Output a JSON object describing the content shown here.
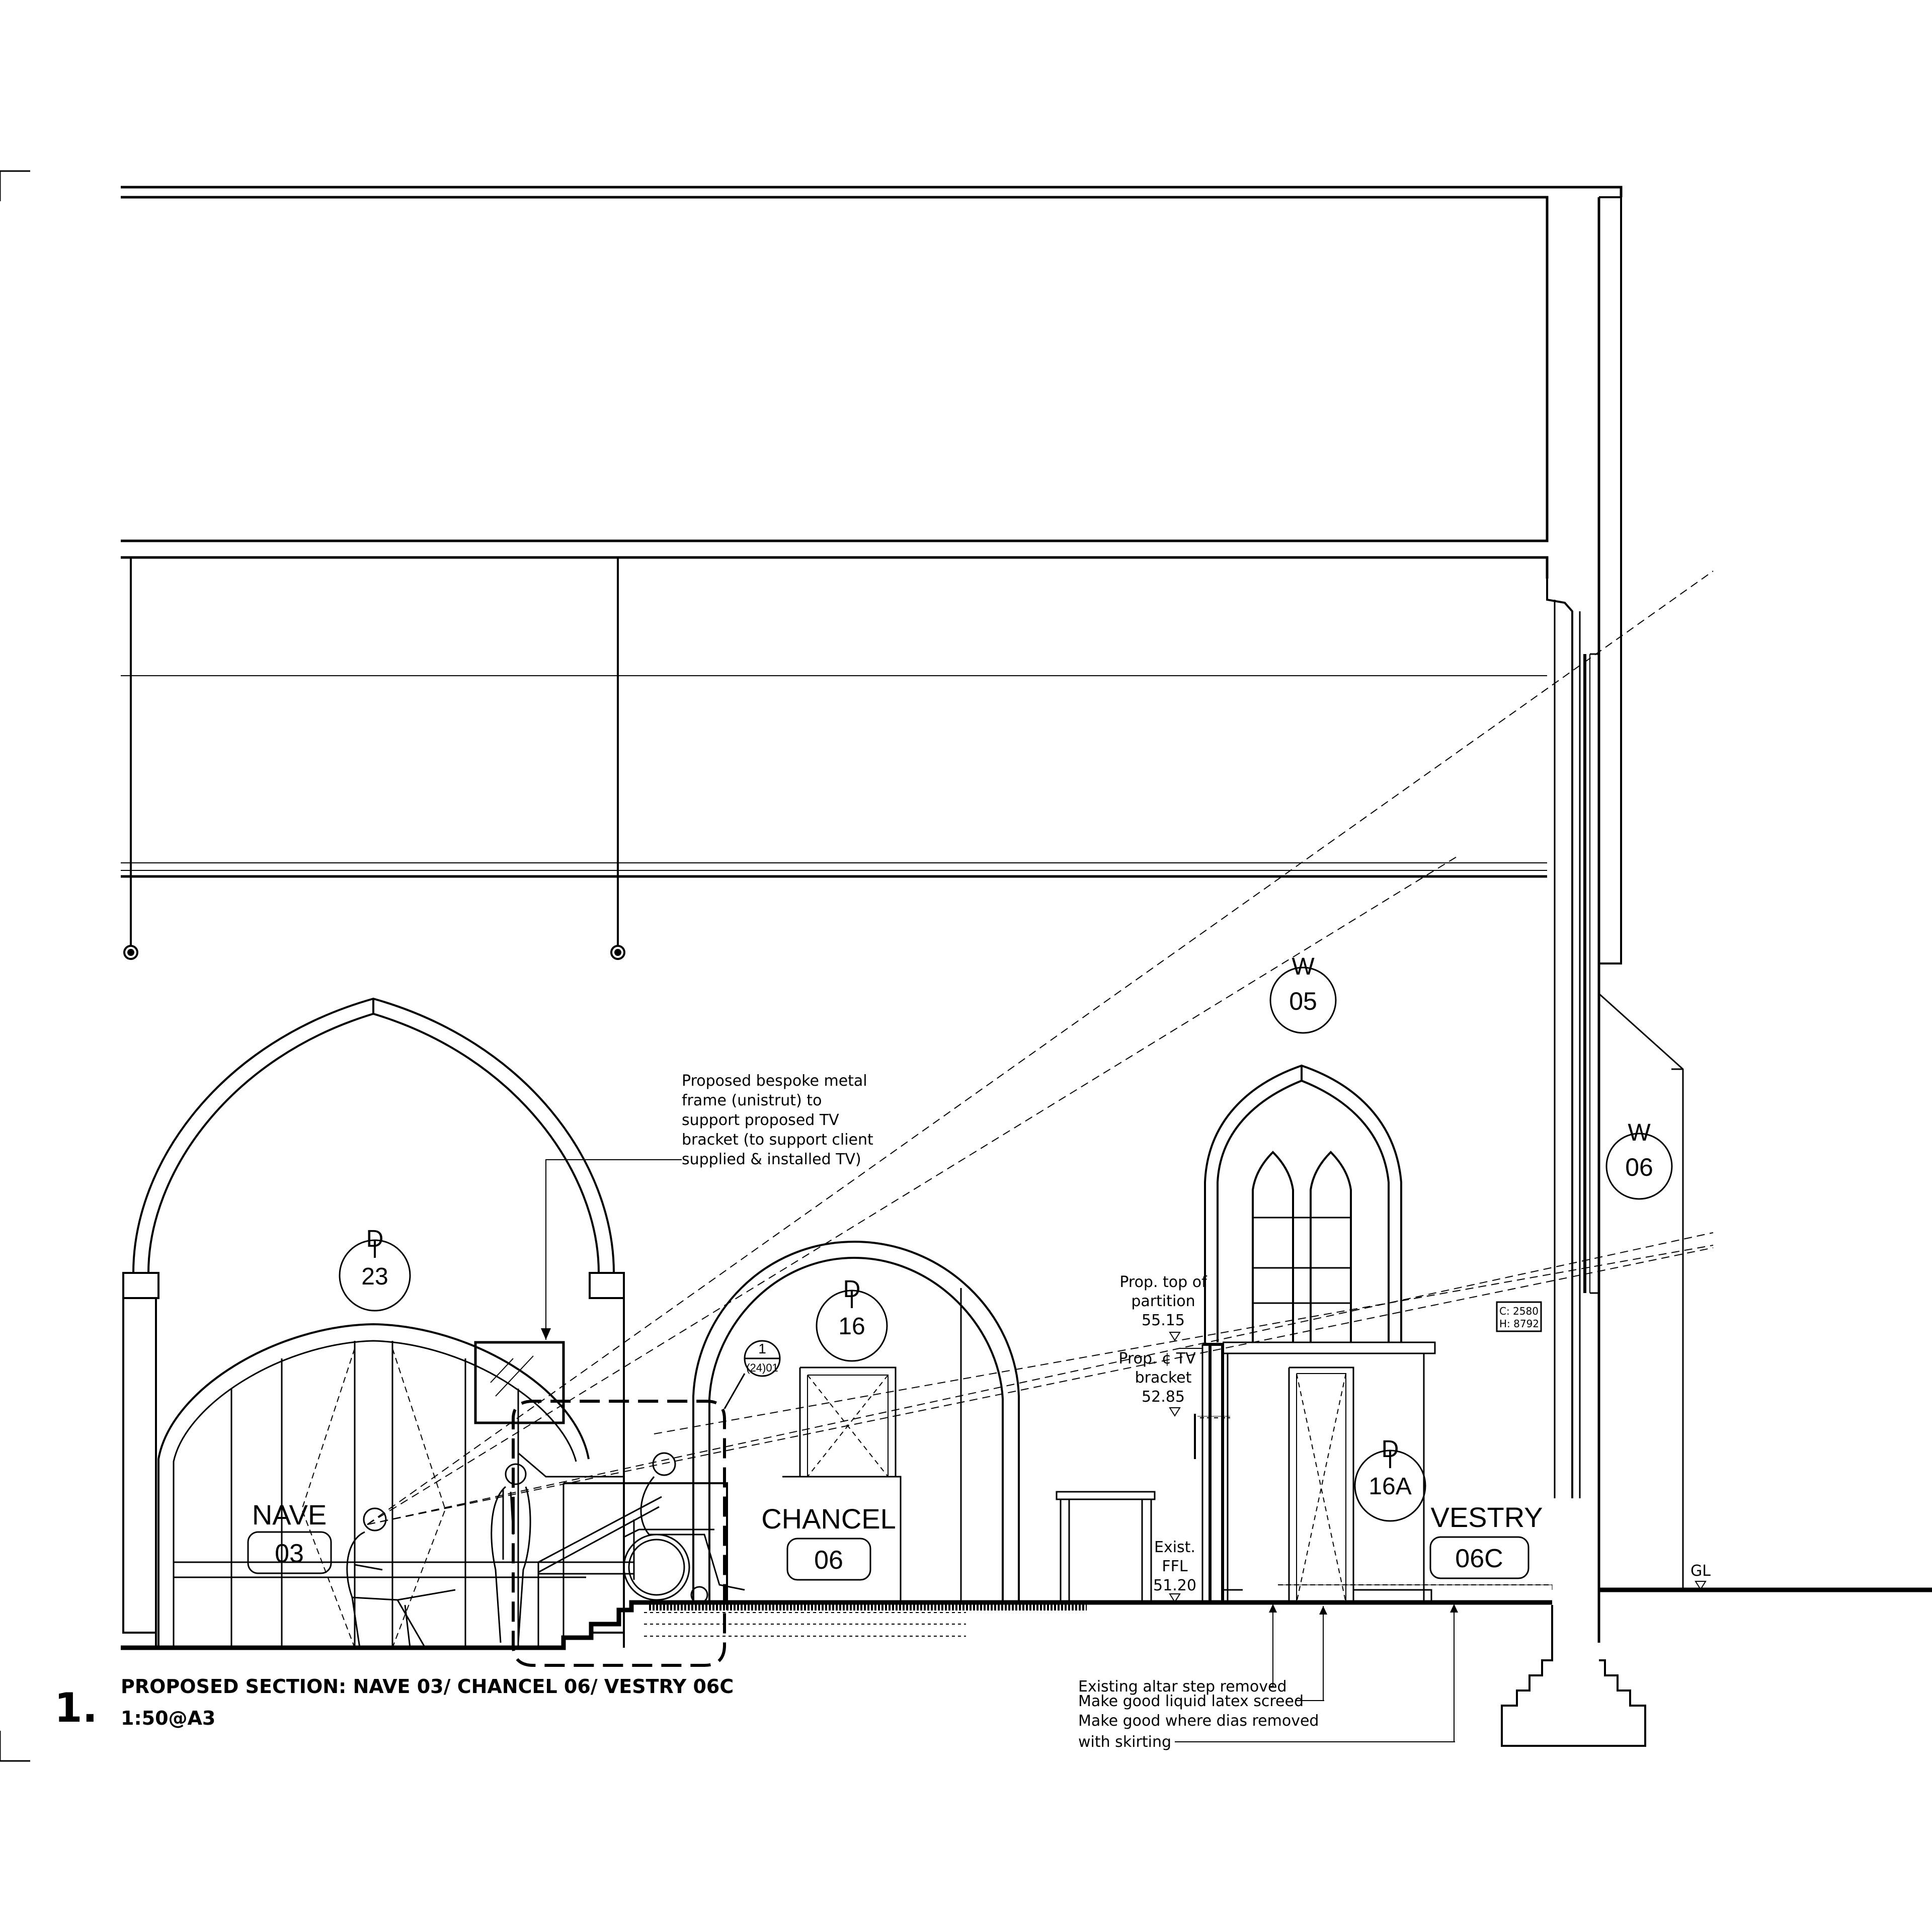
{
  "drawing": {
    "number": "1.",
    "title": "PROPOSED SECTION: NAVE 03/ CHANCEL 06/ VESTRY 06C",
    "scale": "1:50@A3"
  },
  "rooms": [
    {
      "name": "NAVE",
      "number": "03"
    },
    {
      "name": "CHANCEL",
      "number": "06"
    },
    {
      "name": "VESTRY",
      "number": "06C"
    }
  ],
  "door_tags": [
    {
      "type": "D",
      "number": "23"
    },
    {
      "type": "D",
      "number": "16"
    },
    {
      "type": "D",
      "number": "16A"
    }
  ],
  "window_tags": [
    {
      "type": "W",
      "number": "05"
    },
    {
      "type": "W",
      "number": "06"
    }
  ],
  "detail_callout": {
    "number": "1",
    "sheet": "(24)01"
  },
  "frame_note": {
    "lines": [
      "Proposed bespoke metal",
      "frame (unistrut) to",
      "support proposed TV",
      "bracket (to support client",
      "supplied & installed TV)"
    ]
  },
  "levels": [
    {
      "lines": [
        "Prop. top of",
        "partition"
      ],
      "value": "55.15"
    },
    {
      "lines": [
        "Prop. ¢ TV",
        "bracket"
      ],
      "value": "52.85"
    },
    {
      "lines": [
        "Exist.",
        "FFL"
      ],
      "value": "51.20"
    },
    {
      "lines": [
        "GL"
      ],
      "value": ""
    }
  ],
  "floor_notes": [
    "Existing altar step removed",
    "Make good liquid latex screed",
    "Make good where dias removed",
    "with skirting"
  ],
  "sensor_label": [
    "C: 2580",
    "H: 8792"
  ]
}
